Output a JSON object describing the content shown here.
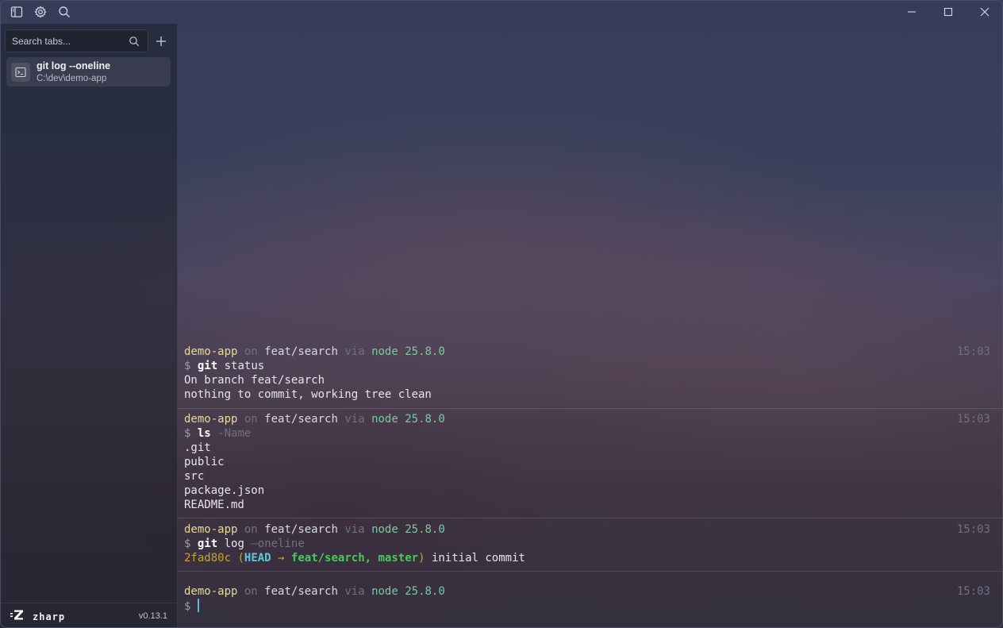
{
  "app": {
    "name": "zharp",
    "version": "v0.13.1"
  },
  "sidebar": {
    "search_placeholder": "Search tabs...",
    "tabs": [
      {
        "title": "git log --oneline",
        "path": "C:\\dev\\demo-app"
      }
    ]
  },
  "terminal": {
    "blocks": [
      {
        "dir": "demo-app",
        "on": "on",
        "branch": "feat/search",
        "via": "via",
        "node": "node 25.8.0",
        "time": "15:03",
        "prompt": "$",
        "cmd": "git",
        "cmd_rest": " status",
        "arg": "",
        "output": [
          "On branch feat/search",
          "nothing to commit, working tree clean"
        ]
      },
      {
        "dir": "demo-app",
        "on": "on",
        "branch": "feat/search",
        "via": "via",
        "node": "node 25.8.0",
        "time": "15:03",
        "prompt": "$",
        "cmd": "ls",
        "cmd_rest": "",
        "arg": " -Name",
        "output": [
          ".git",
          "public",
          "src",
          "package.json",
          "README.md"
        ]
      },
      {
        "dir": "demo-app",
        "on": "on",
        "branch": "feat/search",
        "via": "via",
        "node": "node 25.8.0",
        "time": "15:03",
        "prompt": "$",
        "cmd": "git",
        "cmd_rest": " log",
        "arg": " —oneline",
        "log": {
          "hash": "2fad80c",
          "open": "(",
          "head": "HEAD",
          "arrow": " → ",
          "refs": "feat/search, master",
          "close": ")",
          "msg": "initial commit"
        }
      },
      {
        "dir": "demo-app",
        "on": "on",
        "branch": "feat/search",
        "via": "via",
        "node": "node 25.8.0",
        "time": "15:03",
        "prompt": "$"
      }
    ]
  },
  "colors": {
    "accent": "#5fb8d8",
    "dir": "#e8d9a0",
    "node": "#7cc8a0",
    "ref": "#47c95c",
    "hash": "#c9a227"
  }
}
